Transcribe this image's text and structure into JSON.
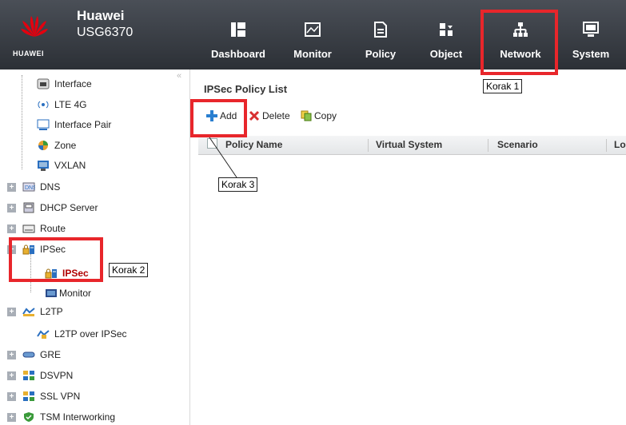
{
  "brand": {
    "logo_text": "HUAWEI",
    "product_line1": "Huawei",
    "product_line2": "USG6370"
  },
  "nav": [
    {
      "label": "Dashboard",
      "icon": "dashboard-icon"
    },
    {
      "label": "Monitor",
      "icon": "monitor-icon"
    },
    {
      "label": "Policy",
      "icon": "policy-icon"
    },
    {
      "label": "Object",
      "icon": "object-icon"
    },
    {
      "label": "Network",
      "icon": "network-icon"
    },
    {
      "label": "System",
      "icon": "system-icon"
    }
  ],
  "sidebar": {
    "collapse_glyph": "«",
    "items": [
      {
        "label": "Interface",
        "icon": "interface-icon"
      },
      {
        "label": "LTE 4G",
        "icon": "lte-icon"
      },
      {
        "label": "Interface Pair",
        "icon": "interface-pair-icon"
      },
      {
        "label": "Zone",
        "icon": "zone-icon"
      },
      {
        "label": "VXLAN",
        "icon": "vxlan-icon"
      },
      {
        "label": "DNS",
        "icon": "dns-icon",
        "expander": "+"
      },
      {
        "label": "DHCP Server",
        "icon": "dhcp-icon",
        "expander": "+"
      },
      {
        "label": "Route",
        "icon": "route-icon",
        "expander": "+"
      },
      {
        "label": "IPSec",
        "icon": "ipsec-icon",
        "expander": "−"
      },
      {
        "label": "IPSec",
        "icon": "ipsec-icon",
        "active": true
      },
      {
        "label": "Monitor",
        "icon": "monitor-small-icon"
      },
      {
        "label": "L2TP",
        "icon": "l2tp-icon",
        "expander": "+"
      },
      {
        "label": "L2TP over IPSec",
        "icon": "l2tp-ipsec-icon"
      },
      {
        "label": "GRE",
        "icon": "gre-icon",
        "expander": "+"
      },
      {
        "label": "DSVPN",
        "icon": "dsvpn-icon",
        "expander": "+"
      },
      {
        "label": "SSL VPN",
        "icon": "sslvpn-icon",
        "expander": "+"
      },
      {
        "label": "TSM Interworking",
        "icon": "tsm-icon",
        "expander": "+"
      }
    ]
  },
  "main": {
    "title": "IPSec Policy List",
    "toolbar": {
      "add": "Add",
      "delete": "Delete",
      "copy": "Copy"
    },
    "columns": [
      "Policy Name",
      "Virtual System",
      "Scenario",
      "Lo"
    ]
  },
  "annotations": {
    "step1": "Korak 1",
    "step2": "Korak 2",
    "step3": "Korak 3"
  },
  "colors": {
    "header_bg": "#2c3036",
    "annotation_red": "#e8262b",
    "active_item": "#b00000",
    "huawei_red": "#e3000f"
  }
}
